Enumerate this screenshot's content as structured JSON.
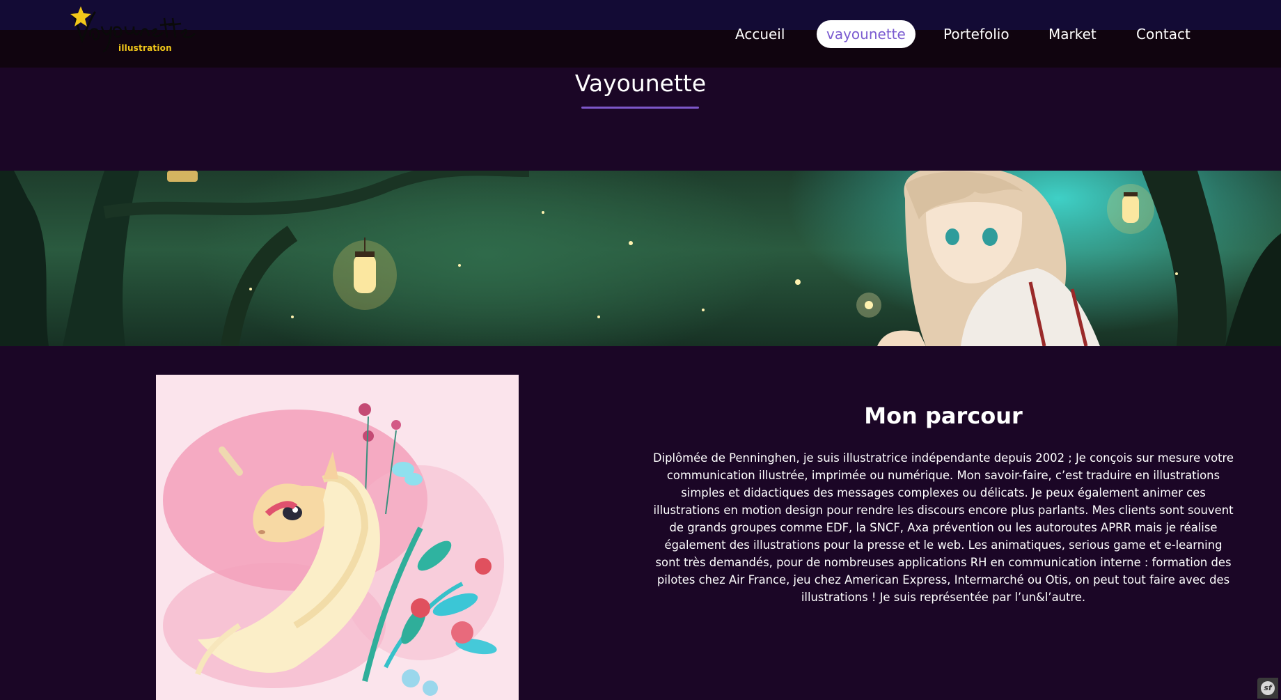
{
  "header": {
    "logo": {
      "script_text": "Vayounette",
      "sub_text": "illustration"
    },
    "nav": [
      {
        "label": "Accueil",
        "active": false
      },
      {
        "label": "vayounette",
        "active": true
      },
      {
        "label": "Portefolio",
        "active": false
      },
      {
        "label": "Market",
        "active": false
      },
      {
        "label": "Contact",
        "active": false
      }
    ]
  },
  "page": {
    "title": "Vayounette"
  },
  "about": {
    "heading": "Mon parcour",
    "body": "Diplômée de Penninghen, je suis illustratrice indépendante depuis 2002 ; Je conçois sur mesure votre communication illustrée, imprimée ou numérique. Mon savoir-faire, c’est traduire en illustrations simples et didactiques des messages complexes ou délicats. Je peux également animer ces illustrations en motion design pour rendre les discours encore plus parlants. Mes clients sont souvent de grands groupes comme EDF, la SNCF, Axa prévention ou les autoroutes APRR mais je réalise également des illustrations pour la presse et le web. Les animatiques, serious game et e-learning sont très demandés, pour de nombreuses applications RH en communication interne : formation des pilotes chez Air France, jeu chez American Express, Intermarché ou Otis, on peut tout faire avec des illustrations ! Je suis représentée par l’un&l’autre."
  },
  "debug_toolbar": {
    "icon": "symfony-icon",
    "glyph": "sf"
  },
  "colors": {
    "header_top": "#130b35",
    "header_bottom": "#10040f",
    "page_background": "#1b0626",
    "accent": "#7d57c9",
    "active_nav_text": "#7a5ad0",
    "logo_yellow": "#f2c81a"
  }
}
